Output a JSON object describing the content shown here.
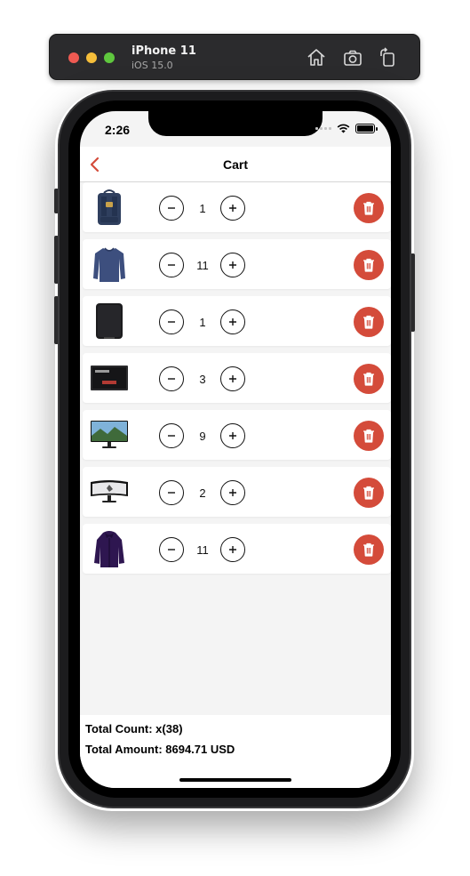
{
  "simulator": {
    "device": "iPhone 11",
    "os": "iOS 15.0",
    "icons": [
      "home-icon",
      "screenshot-icon",
      "rotate-icon"
    ]
  },
  "status_bar": {
    "time": "2:26"
  },
  "nav": {
    "title": "Cart",
    "back_icon": "chevron-left-icon"
  },
  "colors": {
    "accent": "#d44b3a",
    "background": "#f4f4f4"
  },
  "cart": {
    "items": [
      {
        "image": "backpack",
        "qty": "1"
      },
      {
        "image": "sweater",
        "qty": "11"
      },
      {
        "image": "hard-drive",
        "qty": "1"
      },
      {
        "image": "ssd",
        "qty": "3"
      },
      {
        "image": "monitor",
        "qty": "9"
      },
      {
        "image": "curved-monitor",
        "qty": "2"
      },
      {
        "image": "jacket",
        "qty": "11"
      }
    ]
  },
  "footer": {
    "total_count": "Total Count: x(38)",
    "total_amount": "Total Amount: 8694.71 USD"
  }
}
